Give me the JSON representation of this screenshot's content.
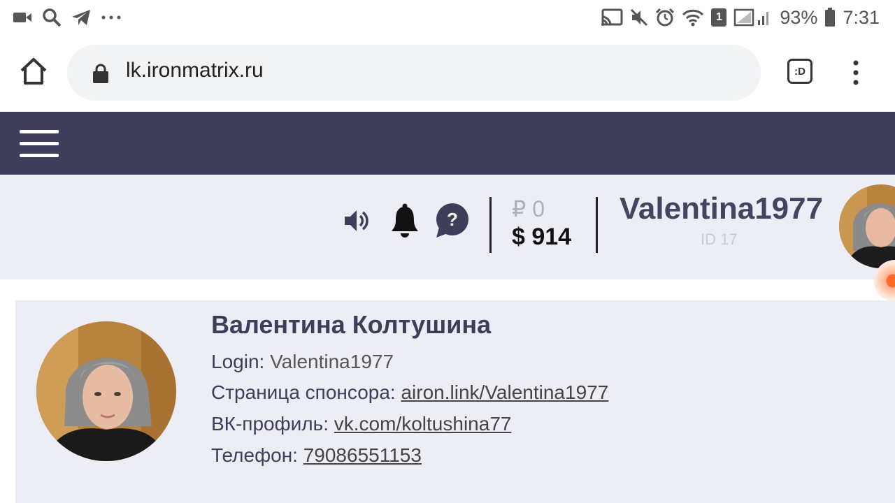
{
  "statusbar": {
    "battery": "93%",
    "time": "7:31",
    "sim_badge": "1"
  },
  "browser": {
    "url": "lk.ironmatrix.ru",
    "tab_switcher_label": ":D"
  },
  "header": {
    "balance_rub": "₽ 0",
    "balance_usd": "$ 914",
    "username": "Valentina1977",
    "user_id": "ID 17"
  },
  "profile": {
    "full_name": "Валентина Колтушина",
    "login_label": "Login:",
    "login_value": "Valentina1977",
    "sponsor_label": "Страница спонсора:",
    "sponsor_link": "airon.link/Valentina1977",
    "vk_label": "ВК-профиль:",
    "vk_link": "vk.com/koltushina77",
    "phone_label": "Телефон:",
    "phone_link": "79086551153"
  },
  "colors": {
    "navbar": "#3e3d5a",
    "infobar": "#ededf5",
    "accent_orange": "#ff6a2a"
  }
}
